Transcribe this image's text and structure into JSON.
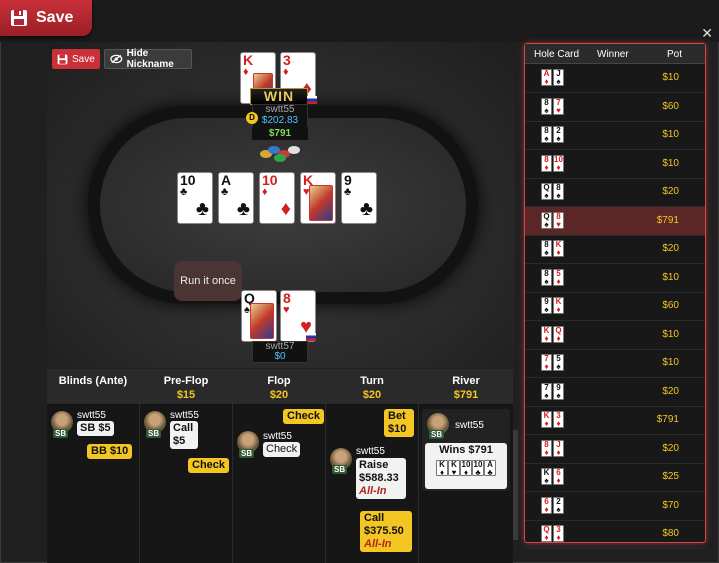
{
  "header": {
    "save_tab_label": "Save",
    "close_symbol": "✕"
  },
  "toolbar": {
    "save_label": "Save",
    "hide_nickname_label": "Hide Nickname"
  },
  "table": {
    "top_player": {
      "name": "swtt55",
      "stack": "$202.83",
      "cards": [
        {
          "rank": "K",
          "suit": "♦"
        },
        {
          "rank": "3",
          "suit": "♦"
        }
      ],
      "result": "WIN"
    },
    "pot": "$791",
    "dealer_button": "D",
    "board": [
      {
        "rank": "10",
        "suit": "♣"
      },
      {
        "rank": "A",
        "suit": "♣"
      },
      {
        "rank": "10",
        "suit": "♦"
      },
      {
        "rank": "K",
        "suit": "♥"
      },
      {
        "rank": "9",
        "suit": "♣"
      }
    ],
    "bottom_player": {
      "name": "swtt57",
      "stack": "$0",
      "cards": [
        {
          "rank": "Q",
          "suit": "♠"
        },
        {
          "rank": "8",
          "suit": "♥"
        }
      ]
    },
    "chat_bubble": "Run it once"
  },
  "streets": [
    {
      "name": "Blinds (Ante)",
      "amount": ""
    },
    {
      "name": "Pre-Flop",
      "amount": "$15"
    },
    {
      "name": "Flop",
      "amount": "$20"
    },
    {
      "name": "Turn",
      "amount": "$20"
    },
    {
      "name": "River",
      "amount": "$791"
    }
  ],
  "actions": {
    "blinds": {
      "player": "swtt55",
      "badge": "SB",
      "act1": "SB $5",
      "act2": "BB $10"
    },
    "preflop": {
      "player": "swtt55",
      "badge": "SB",
      "act1": "Call",
      "act1_amt": "$5",
      "act2": "Check"
    },
    "flop": {
      "player": "swtt55",
      "badge": "SB",
      "act_top": "Check",
      "act1": "Check"
    },
    "turn": {
      "player": "swtt55",
      "badge": "SB",
      "bet": "Bet",
      "bet_amt": "$10",
      "raise": "Raise",
      "raise_amt": "$588.33",
      "allin1": "All-In",
      "call": "Call",
      "call_amt": "$375.50",
      "allin2": "All-In"
    },
    "river": {
      "player": "swtt55",
      "badge": "SB",
      "wins": "Wins $791"
    }
  },
  "history_panel": {
    "headers": {
      "hole_card": "Hole Card",
      "winner": "Winner",
      "pot": "Pot"
    },
    "rows": [
      {
        "c1": "A",
        "s1": "♦",
        "c2": "J",
        "s2": "♠",
        "pot": "$10"
      },
      {
        "c1": "8",
        "s1": "♠",
        "c2": "7",
        "s2": "♥",
        "pot": "$60"
      },
      {
        "c1": "8",
        "s1": "♠",
        "c2": "2",
        "s2": "♠",
        "pot": "$10"
      },
      {
        "c1": "8",
        "s1": "♦",
        "c2": "10",
        "s2": "♦",
        "pot": "$10"
      },
      {
        "c1": "Q",
        "s1": "♠",
        "c2": "8",
        "s2": "♠",
        "pot": "$20"
      },
      {
        "c1": "Q",
        "s1": "♠",
        "c2": "8",
        "s2": "♥",
        "pot": "$791",
        "selected": true
      },
      {
        "c1": "8",
        "s1": "♠",
        "c2": "K",
        "s2": "♦",
        "pot": "$20"
      },
      {
        "c1": "8",
        "s1": "♠",
        "c2": "5",
        "s2": "♦",
        "pot": "$10"
      },
      {
        "c1": "9",
        "s1": "♠",
        "c2": "K",
        "s2": "♦",
        "pot": "$60"
      },
      {
        "c1": "K",
        "s1": "♦",
        "c2": "Q",
        "s2": "♦",
        "pot": "$10"
      },
      {
        "c1": "7",
        "s1": "♦",
        "c2": "5",
        "s2": "♠",
        "pot": "$10"
      },
      {
        "c1": "7",
        "s1": "♠",
        "c2": "9",
        "s2": "♠",
        "pot": "$20"
      },
      {
        "c1": "K",
        "s1": "♦",
        "c2": "3",
        "s2": "♦",
        "pot": "$791"
      },
      {
        "c1": "8",
        "s1": "♦",
        "c2": "J",
        "s2": "♦",
        "pot": "$20"
      },
      {
        "c1": "K",
        "s1": "♠",
        "c2": "6",
        "s2": "♦",
        "pot": "$25"
      },
      {
        "c1": "6",
        "s1": "♦",
        "c2": "2",
        "s2": "♠",
        "pot": "$70"
      },
      {
        "c1": "Q",
        "s1": "♦",
        "c2": "3",
        "s2": "♦",
        "pot": "$80"
      }
    ]
  },
  "colors": {
    "accent": "#c9303a",
    "gold": "#f3c623",
    "stack": "#4fc3f7",
    "pot": "#7ed957"
  }
}
